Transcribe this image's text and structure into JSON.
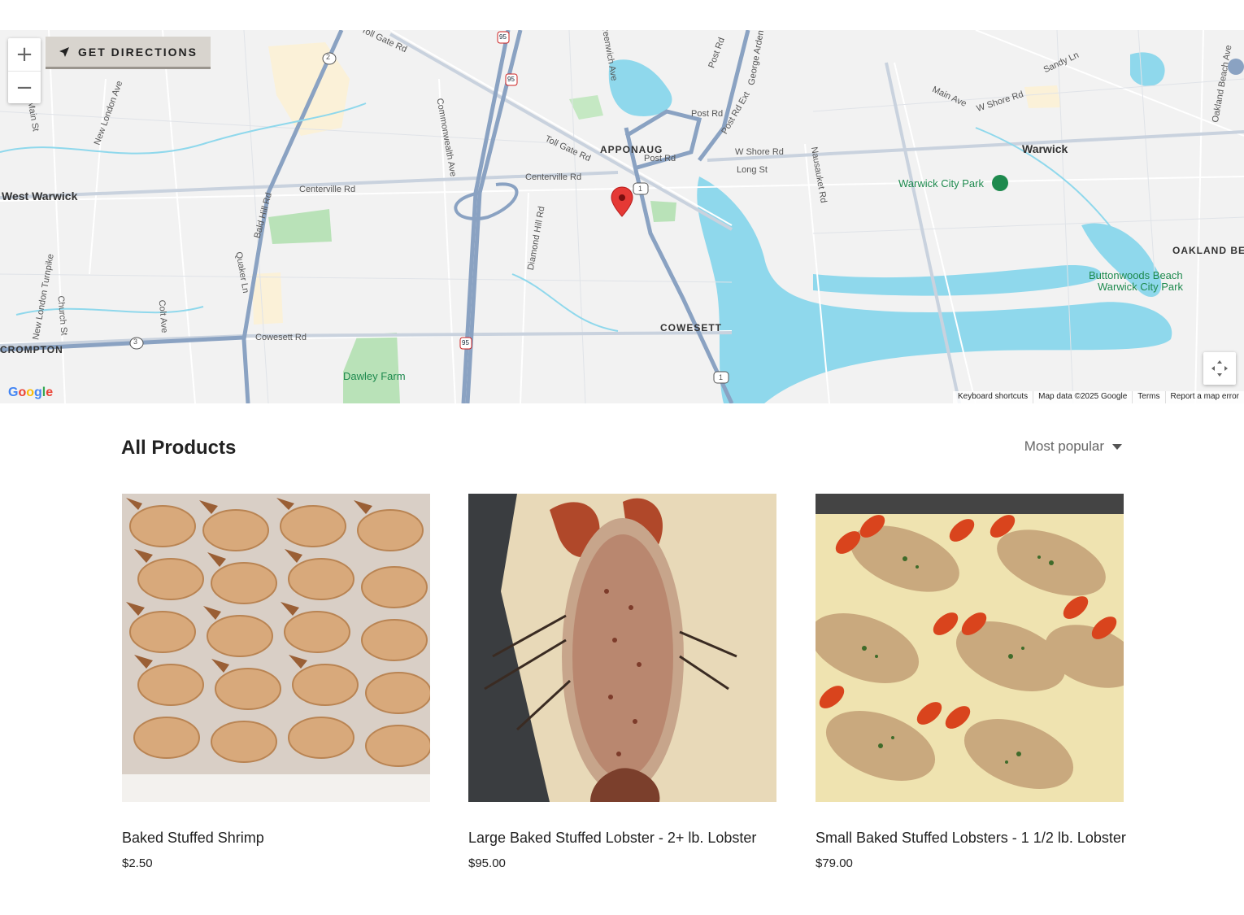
{
  "map": {
    "directions_label": "GET DIRECTIONS",
    "zoom_in_label": "+",
    "zoom_out_label": "−",
    "google_logo": "Google",
    "attribution": {
      "shortcuts": "Keyboard shortcuts",
      "map_data": "Map data ©2025 Google",
      "terms": "Terms",
      "report": "Report a map error"
    },
    "labels": {
      "west_warwick": "West Warwick",
      "apponaug": "APPONAUG",
      "warwick": "Warwick",
      "warwick_city_park": "Warwick City Park",
      "oakland_beach": "OAKLAND BEA",
      "buttonwoods_1": "Buttonwoods Beach",
      "buttonwoods_2": "Warwick City Park",
      "cowesett": "COWESETT",
      "crompton": "CROMPTON",
      "dawley_farm": "Dawley Farm",
      "centerville_rd_1": "Centerville Rd",
      "centerville_rd_2": "Centerville Rd",
      "toll_gate_rd": "Toll Gate Rd",
      "post_rd_1": "Post Rd",
      "post_rd_2": "Post Rd",
      "post_rd_ext": "Post Rd Ext",
      "w_shore_rd": "W Shore Rd",
      "long_st": "Long St",
      "main_ave": "Main Ave",
      "w_shore_rd_2": "W Shore Rd",
      "sandy_ln": "Sandy Ln",
      "cowesett_rd": "Cowesett Rd",
      "commonwealth_ave": "Commonwealth Ave",
      "diamond_hill_rd": "Diamond Hill Rd",
      "bald_hill_rd": "Bald Hill Rd",
      "quaker_ln": "Quaker Ln",
      "new_london_ave": "New London Ave",
      "new_london_tpke": "New London Turnpike",
      "church_st": "Church St",
      "colt_ave": "Colt Ave",
      "main_st": "Main St",
      "nausauket_rd": "Nausauket Rd",
      "greenwich_ave": "Greenwich Ave",
      "george_arden": "George Arden",
      "oakland_beach_ave": "Oakland Beach Ave",
      "toll_gate_rd_top": "Toll Gate Rd",
      "post_rd_top": "Post Rd",
      "route_2": "2",
      "route_3": "3",
      "route_95a": "95",
      "route_95b": "95",
      "route_95c": "95",
      "route_1a": "1",
      "route_1b": "1"
    }
  },
  "products_section": {
    "title": "All Products",
    "sort_label": "Most popular"
  },
  "products": [
    {
      "name": "Baked Stuffed Shrimp",
      "price": "$2.50"
    },
    {
      "name": "Large Baked Stuffed Lobster - 2+ lb. Lobster",
      "price": "$95.00"
    },
    {
      "name": "Small Baked Stuffed Lobsters - 1 1/2 lb. Lobster",
      "price": "$79.00"
    }
  ],
  "colors": {
    "water": "#8fd8ec",
    "land": "#f2f2f2",
    "highway": "#8aa2c2",
    "park": "#b9e2b8",
    "marker": "#e53935"
  }
}
